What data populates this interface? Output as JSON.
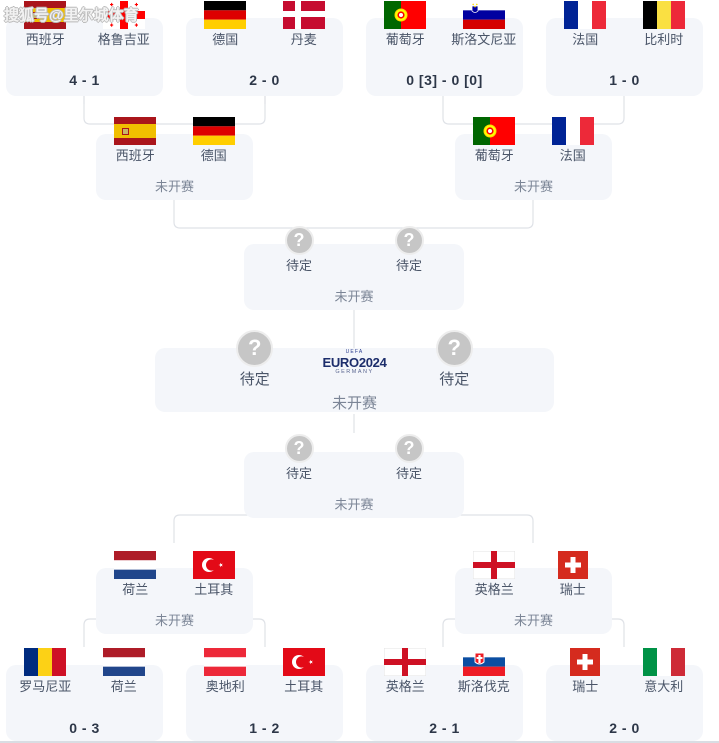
{
  "watermark": "搜狐号@里尔城体育",
  "labels": {
    "tbd": "待定",
    "not_started": "未开赛",
    "question_mark": "?"
  },
  "logo": {
    "arc": "UEFA",
    "main_a": "EURO",
    "main_b": "2024",
    "sub": "GERMANY"
  },
  "teams": {
    "spain": "西班牙",
    "georgia": "格鲁吉亚",
    "germany": "德国",
    "denmark": "丹麦",
    "portugal": "葡萄牙",
    "slovenia": "斯洛文尼亚",
    "france": "法国",
    "belgium": "比利时",
    "romania": "罗马尼亚",
    "netherlands": "荷兰",
    "austria": "奥地利",
    "turkey": "土耳其",
    "england": "英格兰",
    "slovakia": "斯洛伐克",
    "switzerland": "瑞士",
    "italy": "意大利"
  },
  "rounds": {
    "round16_top": [
      {
        "id": "r16-esp-geo",
        "home": "西班牙",
        "away": "格鲁吉亚",
        "home_flag": "spain",
        "away_flag": "georgia",
        "score": "4 - 1",
        "home_score": "4",
        "away_score": "1",
        "status": ""
      },
      {
        "id": "r16-ger-den",
        "home": "德国",
        "away": "丹麦",
        "home_flag": "germany",
        "away_flag": "denmark",
        "score": "2 - 0",
        "home_score": "2",
        "away_score": "0",
        "status": ""
      },
      {
        "id": "r16-por-svn",
        "home": "葡萄牙",
        "away": "斯洛文尼亚",
        "home_flag": "portugal",
        "away_flag": "slovenia",
        "score": "0 [3] - 0 [0]",
        "home_score": "0 [3]",
        "away_score": "0 [0]",
        "status": ""
      },
      {
        "id": "r16-fra-bel",
        "home": "法国",
        "away": "比利时",
        "home_flag": "france",
        "away_flag": "belgium",
        "score": "1 - 0",
        "home_score": "1",
        "away_score": "0",
        "status": ""
      }
    ],
    "round16_bottom": [
      {
        "id": "r16-rou-ned",
        "home": "罗马尼亚",
        "away": "荷兰",
        "home_flag": "romania",
        "away_flag": "netherlands",
        "score": "0 - 3",
        "home_score": "0",
        "away_score": "3",
        "status": ""
      },
      {
        "id": "r16-aut-tur",
        "home": "奥地利",
        "away": "土耳其",
        "home_flag": "austria",
        "away_flag": "turkey",
        "score": "1 - 2",
        "home_score": "1",
        "away_score": "2",
        "status": ""
      },
      {
        "id": "r16-eng-svk",
        "home": "英格兰",
        "away": "斯洛伐克",
        "home_flag": "england",
        "away_flag": "slovakia",
        "score": "2 - 1",
        "home_score": "2",
        "away_score": "1",
        "status": ""
      },
      {
        "id": "r16-sui-ita",
        "home": "瑞士",
        "away": "意大利",
        "home_flag": "switzerland",
        "away_flag": "italy",
        "score": "2 - 0",
        "home_score": "2",
        "away_score": "0",
        "status": ""
      }
    ],
    "quarterfinals_top": [
      {
        "id": "qf-esp-ger",
        "home": "西班牙",
        "away": "德国",
        "home_flag": "spain",
        "away_flag": "germany",
        "score": "",
        "status": "未开赛"
      },
      {
        "id": "qf-por-fra",
        "home": "葡萄牙",
        "away": "法国",
        "home_flag": "portugal",
        "away_flag": "france",
        "score": "",
        "status": "未开赛"
      }
    ],
    "quarterfinals_bottom": [
      {
        "id": "qf-ned-tur",
        "home": "荷兰",
        "away": "土耳其",
        "home_flag": "netherlands",
        "away_flag": "turkey",
        "score": "",
        "status": "未开赛"
      },
      {
        "id": "qf-eng-sui",
        "home": "英格兰",
        "away": "瑞士",
        "home_flag": "england",
        "away_flag": "switzerland",
        "score": "",
        "status": "未开赛"
      }
    ],
    "semifinals": [
      {
        "id": "sf-top",
        "home": "待定",
        "away": "待定",
        "home_flag": "unknown",
        "away_flag": "unknown",
        "score": "",
        "status": "未开赛"
      },
      {
        "id": "sf-bottom",
        "home": "待定",
        "away": "待定",
        "home_flag": "unknown",
        "away_flag": "unknown",
        "score": "",
        "status": "未开赛"
      }
    ],
    "final": {
      "id": "final",
      "home": "待定",
      "away": "待定",
      "home_flag": "unknown",
      "away_flag": "unknown",
      "score": "",
      "status": "未开赛"
    }
  },
  "colors": {
    "card_bg": "#f4f6fa",
    "team_text": "#4a5568",
    "score_text": "#2d3748",
    "status_text": "#7b8596",
    "line": "#dfe2e7",
    "qmark_bg": "#c6c6c6"
  }
}
